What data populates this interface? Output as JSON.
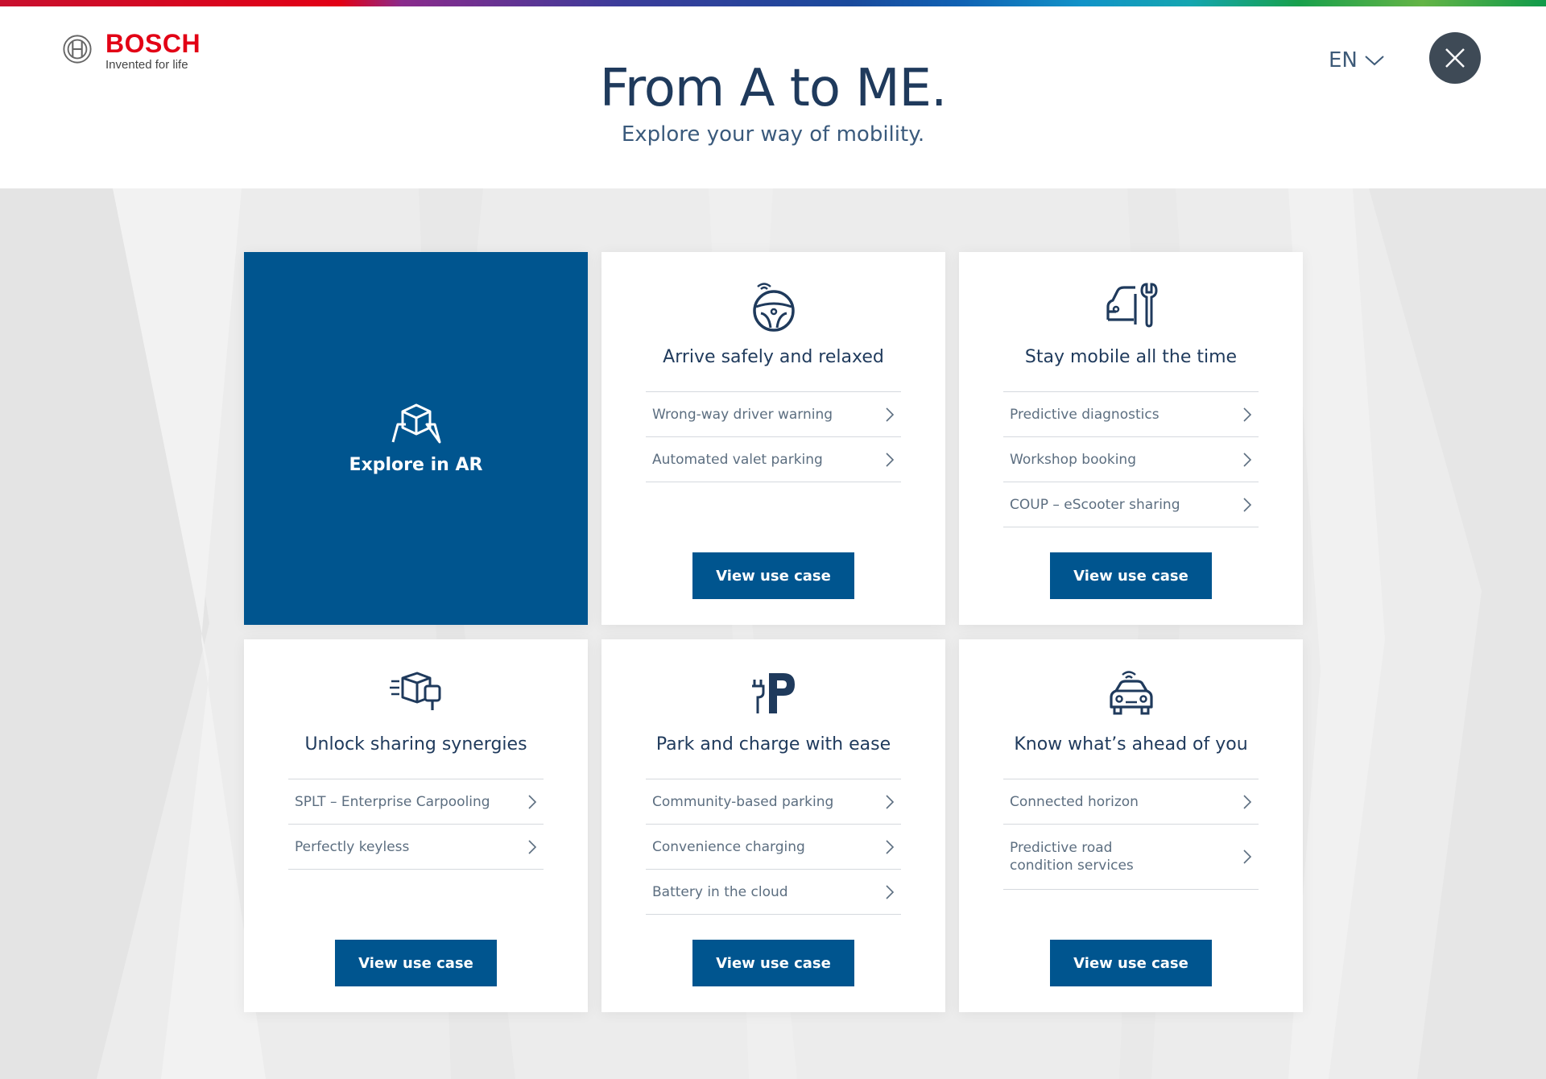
{
  "colors": {
    "brand_red": "#e20015",
    "brand_blue": "#00558f",
    "text_dark": "#1f3a5c",
    "close_bg": "#3e4a56"
  },
  "brand": {
    "name": "BOSCH",
    "tagline": "Invented for life"
  },
  "header": {
    "title": "From A to ME.",
    "subtitle": "Explore your way of mobility."
  },
  "language": {
    "selected": "EN",
    "icon": "chevron-down-icon"
  },
  "close": {
    "icon": "close-icon"
  },
  "ar_card": {
    "label": "Explore in AR",
    "icon": "ar-box-icon"
  },
  "cards": [
    {
      "title": "Arrive safely and relaxed",
      "icon": "connected-steering-wheel-icon",
      "items": [
        "Wrong-way driver warning",
        "Automated valet parking"
      ],
      "button": "View use case"
    },
    {
      "title": "Stay mobile all the time",
      "icon": "car-wrench-icon",
      "items": [
        "Predictive diagnostics",
        "Workshop booking",
        "COUP – eScooter sharing"
      ],
      "button": "View use case"
    },
    {
      "title": "Unlock sharing synergies",
      "icon": "package-key-icon",
      "items": [
        "SPLT – Enterprise Carpooling",
        "Perfectly keyless"
      ],
      "button": "View use case"
    },
    {
      "title": "Park and charge with ease",
      "icon": "parking-charge-icon",
      "items": [
        "Community-based parking",
        "Convenience charging",
        "Battery in the cloud"
      ],
      "button": "View use case"
    },
    {
      "title": "Know what’s ahead of you",
      "icon": "connected-car-icon",
      "items": [
        "Connected horizon",
        "Predictive road\ncondition services"
      ],
      "button": "View use case"
    }
  ]
}
